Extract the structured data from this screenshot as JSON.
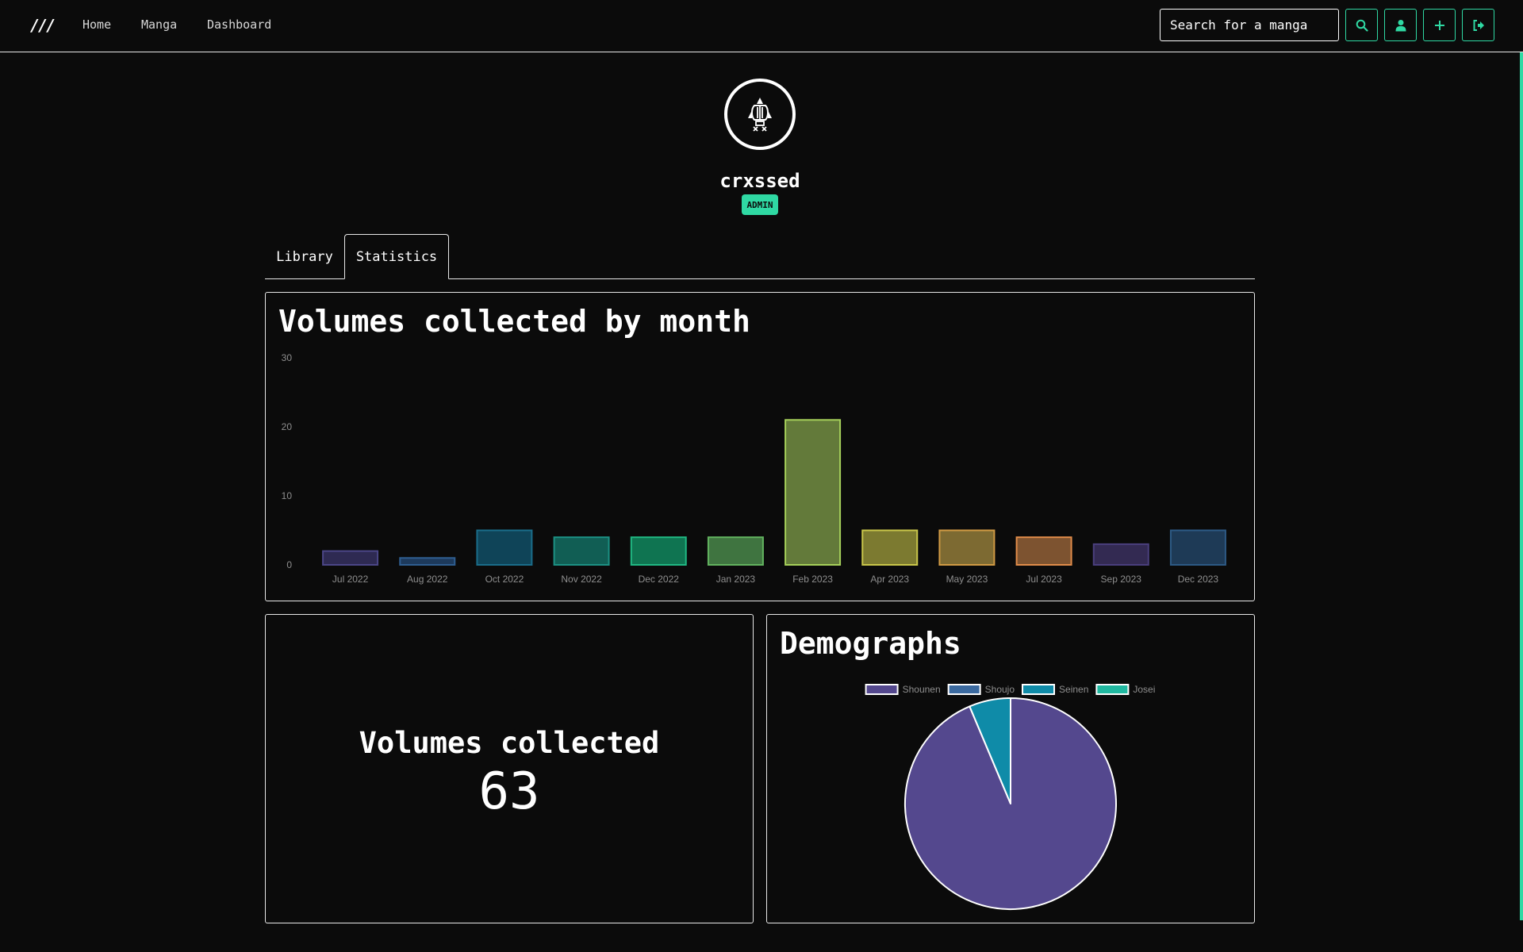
{
  "nav": {
    "logo": "///",
    "links": [
      "Home",
      "Manga",
      "Dashboard"
    ],
    "search_placeholder": "Search for a manga",
    "buttons": [
      "search-icon",
      "user-icon",
      "plus-icon",
      "logout-icon"
    ],
    "accent": "#2fd9a3"
  },
  "profile": {
    "avatar_icon": "rocket-icon",
    "username": "crxssed",
    "role": "ADMIN"
  },
  "tabs": [
    "Library",
    "Statistics"
  ],
  "active_tab": "Statistics",
  "monthly": {
    "title": "Volumes collected by month"
  },
  "summary": {
    "title": "Volumes collected",
    "value": "63"
  },
  "demographs": {
    "title": "Demographs"
  },
  "chart_data": [
    {
      "type": "bar",
      "categories": [
        "Jul 2022",
        "Aug 2022",
        "Oct 2022",
        "Nov 2022",
        "Dec 2022",
        "Jan 2023",
        "Feb 2023",
        "Apr 2023",
        "May 2023",
        "Jul 2023",
        "Sep 2023",
        "Dec 2023"
      ],
      "values": [
        2,
        1,
        5,
        4,
        4,
        4,
        21,
        5,
        5,
        4,
        3,
        5
      ],
      "ylim": [
        0,
        30
      ],
      "yticks": [
        0,
        10,
        20,
        30
      ],
      "fills": [
        "#2e2a52",
        "#1d3a5c",
        "#0f4458",
        "#115e54",
        "#0f7451",
        "#3f7440",
        "#637a3a",
        "#7c7a30",
        "#7d6a32",
        "#7d5330",
        "#332a52",
        "#1e3a56"
      ],
      "borders": [
        "#4b4687",
        "#2f5e91",
        "#1a6d8a",
        "#1c9184",
        "#20b883",
        "#62b35f",
        "#a6d05a",
        "#c9c64a",
        "#d09a44",
        "#e08c4a",
        "#4a3f7d",
        "#2d5a85"
      ],
      "title": "",
      "xlabel": "",
      "ylabel": "",
      "grid": false
    },
    {
      "type": "pie",
      "labels": [
        "Shounen",
        "Shoujo",
        "Seinen",
        "Josei"
      ],
      "values": [
        59,
        0,
        4,
        0
      ],
      "colors": [
        "#54488e",
        "#3b6aa0",
        "#0f8ba8",
        "#20b8a0"
      ],
      "legend": "top"
    }
  ]
}
